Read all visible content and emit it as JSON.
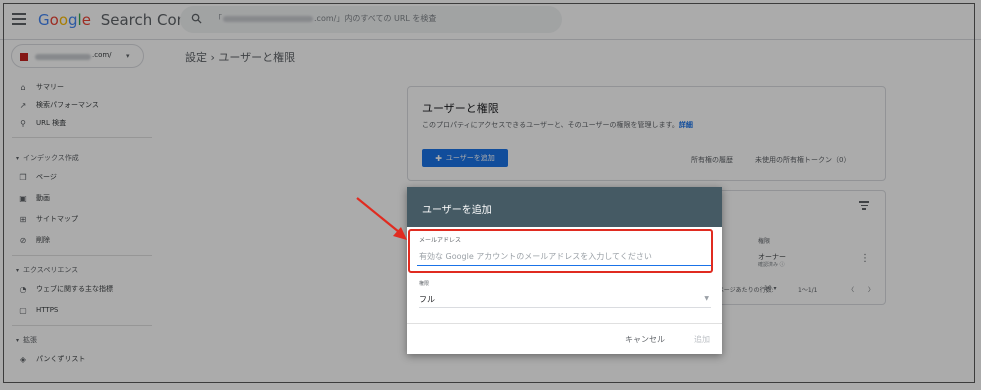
{
  "app": {
    "logo_google": [
      "G",
      "o",
      "o",
      "g",
      "l",
      "e"
    ],
    "logo_product": "Search Console"
  },
  "search": {
    "prefix": "「",
    "suffix": ".com/」内のすべての URL を検査"
  },
  "property": {
    "label": ".com/",
    "caret": "▾"
  },
  "breadcrumb": "設定 › ユーザーと権限",
  "sidebar": {
    "items_top": [
      {
        "icon": "home-icon",
        "glyph": "⌂",
        "label": "サマリー"
      },
      {
        "icon": "trending-up-icon",
        "glyph": "↗",
        "label": "検索パフォーマンス"
      },
      {
        "icon": "search-icon",
        "glyph": "⚲",
        "label": "URL 検査"
      }
    ],
    "section_index": "インデックス作成",
    "items_index": [
      {
        "icon": "pages-icon",
        "glyph": "❐",
        "label": "ページ"
      },
      {
        "icon": "video-icon",
        "glyph": "▣",
        "label": "動画"
      },
      {
        "icon": "sitemap-icon",
        "glyph": "⊞",
        "label": "サイトマップ"
      },
      {
        "icon": "removals-icon",
        "glyph": "⊘",
        "label": "削除"
      }
    ],
    "section_experience": "エクスペリエンス",
    "items_experience": [
      {
        "icon": "gauge-icon",
        "glyph": "◔",
        "label": "ウェブに関する主な指標"
      },
      {
        "icon": "lock-icon",
        "glyph": "▢",
        "label": "HTTPS"
      }
    ],
    "section_enhancements": "拡張",
    "items_enhancements": [
      {
        "icon": "breadcrumb-icon",
        "glyph": "◈",
        "label": "パンくずリスト"
      }
    ]
  },
  "users_card": {
    "title": "ユーザーと権限",
    "description": "このプロパティにアクセスできるユーザーと、そのユーザーの権限を管理します。",
    "details_link": "詳細",
    "add_user_button": "ユーザーを追加",
    "ownership_history": "所有権の履歴",
    "unused_tokens": "未使用の所有権トークン（0）"
  },
  "users_table": {
    "permission_header": "権限",
    "role": "オーナー",
    "role_status": "確認済み ⓘ",
    "rows_per_page_label": "1 ページあたりの行数:",
    "rows_per_page": "10",
    "range": "1〜1/1",
    "prev": "〈",
    "next": "〉"
  },
  "dialog": {
    "title": "ユーザーを追加",
    "email_label": "メールアドレス",
    "email_placeholder": "有効な Google アカウントのメールアドレスを入力してください",
    "permission_label": "権限",
    "permission_value": "フル",
    "cancel": "キャンセル",
    "add": "追加"
  },
  "colors": {
    "accent": "#1a73e8",
    "dialog_header": "#455a64",
    "annotation": "#e02b20"
  }
}
